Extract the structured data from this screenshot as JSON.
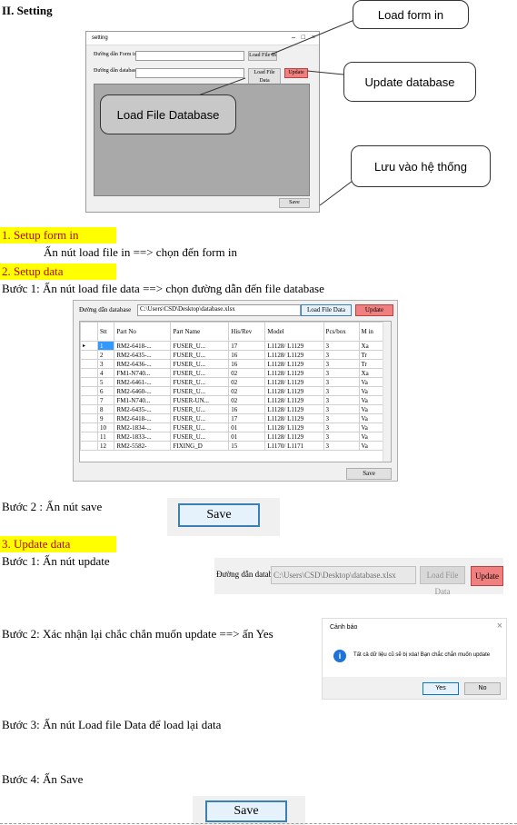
{
  "heading": "II. Setting",
  "form1": {
    "title": "setting",
    "label_form": "Đường dẫn Form in",
    "label_db": "Đường dẫn database",
    "btn_load_form": "Load File In",
    "btn_load_data": "Load File Data",
    "btn_update": "Update",
    "btn_save": "Save"
  },
  "callouts": {
    "load_form": "Load form  in",
    "update_db": "Update database",
    "load_file_db": "Load File  Database",
    "save_system": "Lưu vào hệ thống"
  },
  "sections": {
    "s1_title": "1. Setup form in",
    "s1_text": "Ấn nút load file in ==> chọn đến form in",
    "s2_title": "2. Setup data",
    "s2_step1": "Bước 1: Ấn nút load file data ==> chọn đường dẫn đến file database",
    "s2_step2": "Bước 2 : Ấn nút save",
    "s3_title": "3. Update data",
    "s3_step1": "Bước 1:  Ấn nút update",
    "s3_step2": "Bước 2: Xác nhận lại chắc chắn muốn update ==> ấn Yes",
    "s3_step3": "Bước 3: Ấn nút Load file Data để load lại data",
    "s3_step4": "Bước 4: Ấn Save"
  },
  "form2": {
    "label_db": "Đường dẫn database",
    "path": "C:\\Users\\CSD\\Desktop\\database.xlsx",
    "btn_load_data": "Load File Data",
    "btn_update": "Update",
    "btn_save": "Save",
    "columns": [
      "Stt",
      "Part No",
      "Part Name",
      "His/Rev",
      "Model",
      "Pcs/box",
      "M in"
    ],
    "rows": [
      [
        "1",
        "RM2-6418-...",
        "FUSER_U...",
        "17",
        "L1128/ L1129",
        "3",
        "Xa"
      ],
      [
        "2",
        "RM2-6435-...",
        "FUSER_U...",
        "16",
        "L1128/ L1129",
        "3",
        "Tr"
      ],
      [
        "3",
        "RM2-6436-...",
        "FUSER_U...",
        "16",
        "L1128/ L1129",
        "3",
        "Tr"
      ],
      [
        "4",
        "FM1-N740...",
        "FUSER_U...",
        "02",
        "L1128/ L1129",
        "3",
        "Xa"
      ],
      [
        "5",
        "RM2-6461-...",
        "FUSER_U...",
        "02",
        "L1128/ L1129",
        "3",
        "Va"
      ],
      [
        "6",
        "RM2-6460-...",
        "FUSER_U...",
        "02",
        "L1128/ L1129",
        "3",
        "Va"
      ],
      [
        "7",
        "FM1-N740...",
        "FUSER-UN...",
        "02",
        "L1128/ L1129",
        "3",
        "Va"
      ],
      [
        "8",
        "RM2-6435-...",
        "FUSER_U...",
        "16",
        "L1128/ L1129",
        "3",
        "Va"
      ],
      [
        "9",
        "RM2-6418-...",
        "FUSER_U...",
        "17",
        "L1128/ L1129",
        "3",
        "Va"
      ],
      [
        "10",
        "RM2-1834-...",
        "FUSER_U...",
        "01",
        "L1128/ L1129",
        "3",
        "Va"
      ],
      [
        "11",
        "RM2-1833-...",
        "FUSER_U...",
        "01",
        "L1128/ L1129",
        "3",
        "Va"
      ],
      [
        "12",
        "RM2-5582-",
        "FIXING_D",
        "15",
        "L1170/ L1171",
        "3",
        "Va"
      ]
    ]
  },
  "save_btn_label": "Save",
  "update_panel": {
    "label": "Đường dẫn database",
    "path": "C:\\Users\\CSD\\Desktop\\database.xlsx",
    "btn_load": "Load File Data",
    "btn_update": "Update"
  },
  "dialog": {
    "title": "Cảnh báo",
    "message": "Tất cả dữ liệu cũ sẽ bị xóa! Bạn chắc chắn muốn update",
    "yes": "Yes",
    "no": "No",
    "close": "×",
    "info": "i"
  },
  "colors": {
    "highlight": "#ffff00",
    "section_title": "#c00000",
    "update_btn": "#f08080",
    "selected_row": "#3399ff"
  }
}
